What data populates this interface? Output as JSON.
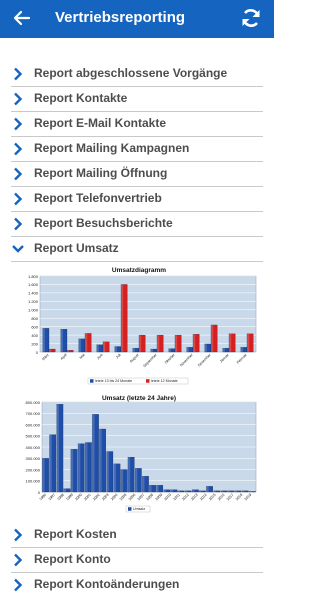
{
  "header": {
    "title": "Vertriebsreporting",
    "back_icon": "arrow-left-icon",
    "refresh_icon": "refresh-icon",
    "color": "#1565c0"
  },
  "reports_top": [
    {
      "label": "Report abgeschlossene Vorgänge",
      "icon": "chevron-right-icon"
    },
    {
      "label": "Report Kontakte",
      "icon": "chevron-right-icon"
    },
    {
      "label": "Report E-Mail Kontakte",
      "icon": "chevron-right-icon"
    },
    {
      "label": "Report Mailing Kampagnen",
      "icon": "chevron-right-icon"
    },
    {
      "label": "Report Mailing Öffnung",
      "icon": "chevron-right-icon"
    },
    {
      "label": "Report Telefonvertrieb",
      "icon": "chevron-right-icon"
    },
    {
      "label": "Report Besuchsberichte",
      "icon": "chevron-right-icon"
    },
    {
      "label": "Report Umsatz",
      "icon": "chevron-down-icon"
    }
  ],
  "reports_bottom": [
    {
      "label": "Report Kosten",
      "icon": "chevron-right-icon"
    },
    {
      "label": "Report Konto",
      "icon": "chevron-right-icon"
    },
    {
      "label": "Report Kontoänderungen",
      "icon": "chevron-right-icon"
    }
  ],
  "chart_data": [
    {
      "type": "bar",
      "title": "Umsatzdiagramm",
      "categories": [
        "März",
        "April",
        "Mai",
        "Juni",
        "Juli",
        "August",
        "September",
        "Oktober",
        "November",
        "Dezember",
        "Januar",
        "Februar"
      ],
      "series": [
        {
          "name": "letzte 13 bis 24 Monate",
          "color": "#1f4ea8",
          "values": [
            560,
            540,
            310,
            170,
            130,
            90,
            70,
            80,
            110,
            190,
            90,
            110
          ]
        },
        {
          "name": "letzte 12 Monate",
          "color": "#d42020",
          "values": [
            70,
            40,
            440,
            240,
            1600,
            400,
            400,
            400,
            420,
            640,
            430,
            430
          ]
        }
      ],
      "yticks": [
        "0",
        "200",
        "400",
        "600",
        "800",
        "1.000",
        "1.200",
        "1.400",
        "1.600",
        "1.800"
      ],
      "ylim": [
        0,
        1800
      ],
      "grid": true,
      "legend": "bottom",
      "plot_bg": "#c9d9ea"
    },
    {
      "type": "bar",
      "title": "Umsatz (letzte 24 Jahre)",
      "categories": [
        "1996",
        "1997",
        "1998",
        "1999",
        "2000",
        "2001",
        "2002",
        "2003",
        "2004",
        "2005",
        "2006",
        "2007",
        "2008",
        "2009",
        "2010",
        "2011",
        "2012",
        "2013",
        "2014",
        "2015",
        "2016",
        "2017",
        "2018",
        "2019",
        "2020",
        "2021",
        "2022",
        "2023",
        "2024",
        "2025"
      ],
      "category_ticks": [
        "1996",
        "1997",
        "1998",
        "1999",
        "2000",
        "2001",
        "2002",
        "2003",
        "2004",
        "2005",
        "2006",
        "2007",
        "2008",
        "2009",
        "2010",
        "2011",
        "2012",
        "2013",
        "2014",
        "2015",
        "2016",
        "2017",
        "2018",
        "2019"
      ],
      "series": [
        {
          "name": "Umsatz",
          "color": "#1f4ea8",
          "values": [
            300000,
            510000,
            780000,
            30000,
            380000,
            430000,
            440000,
            690000,
            560000,
            360000,
            250000,
            200000,
            310000,
            210000,
            140000,
            60000,
            60000,
            20000,
            20000,
            10000,
            10000,
            20000,
            10000,
            50000,
            10000,
            10000,
            10000,
            10000,
            10000,
            5000
          ]
        }
      ],
      "yticks": [
        "0",
        "100.000",
        "200.000",
        "300.000",
        "400.000",
        "500.000",
        "600.000",
        "700.000",
        "800.000"
      ],
      "ylim": [
        0,
        800000
      ],
      "grid": true,
      "legend": "bottom",
      "plot_bg": "#c9d9ea"
    }
  ]
}
